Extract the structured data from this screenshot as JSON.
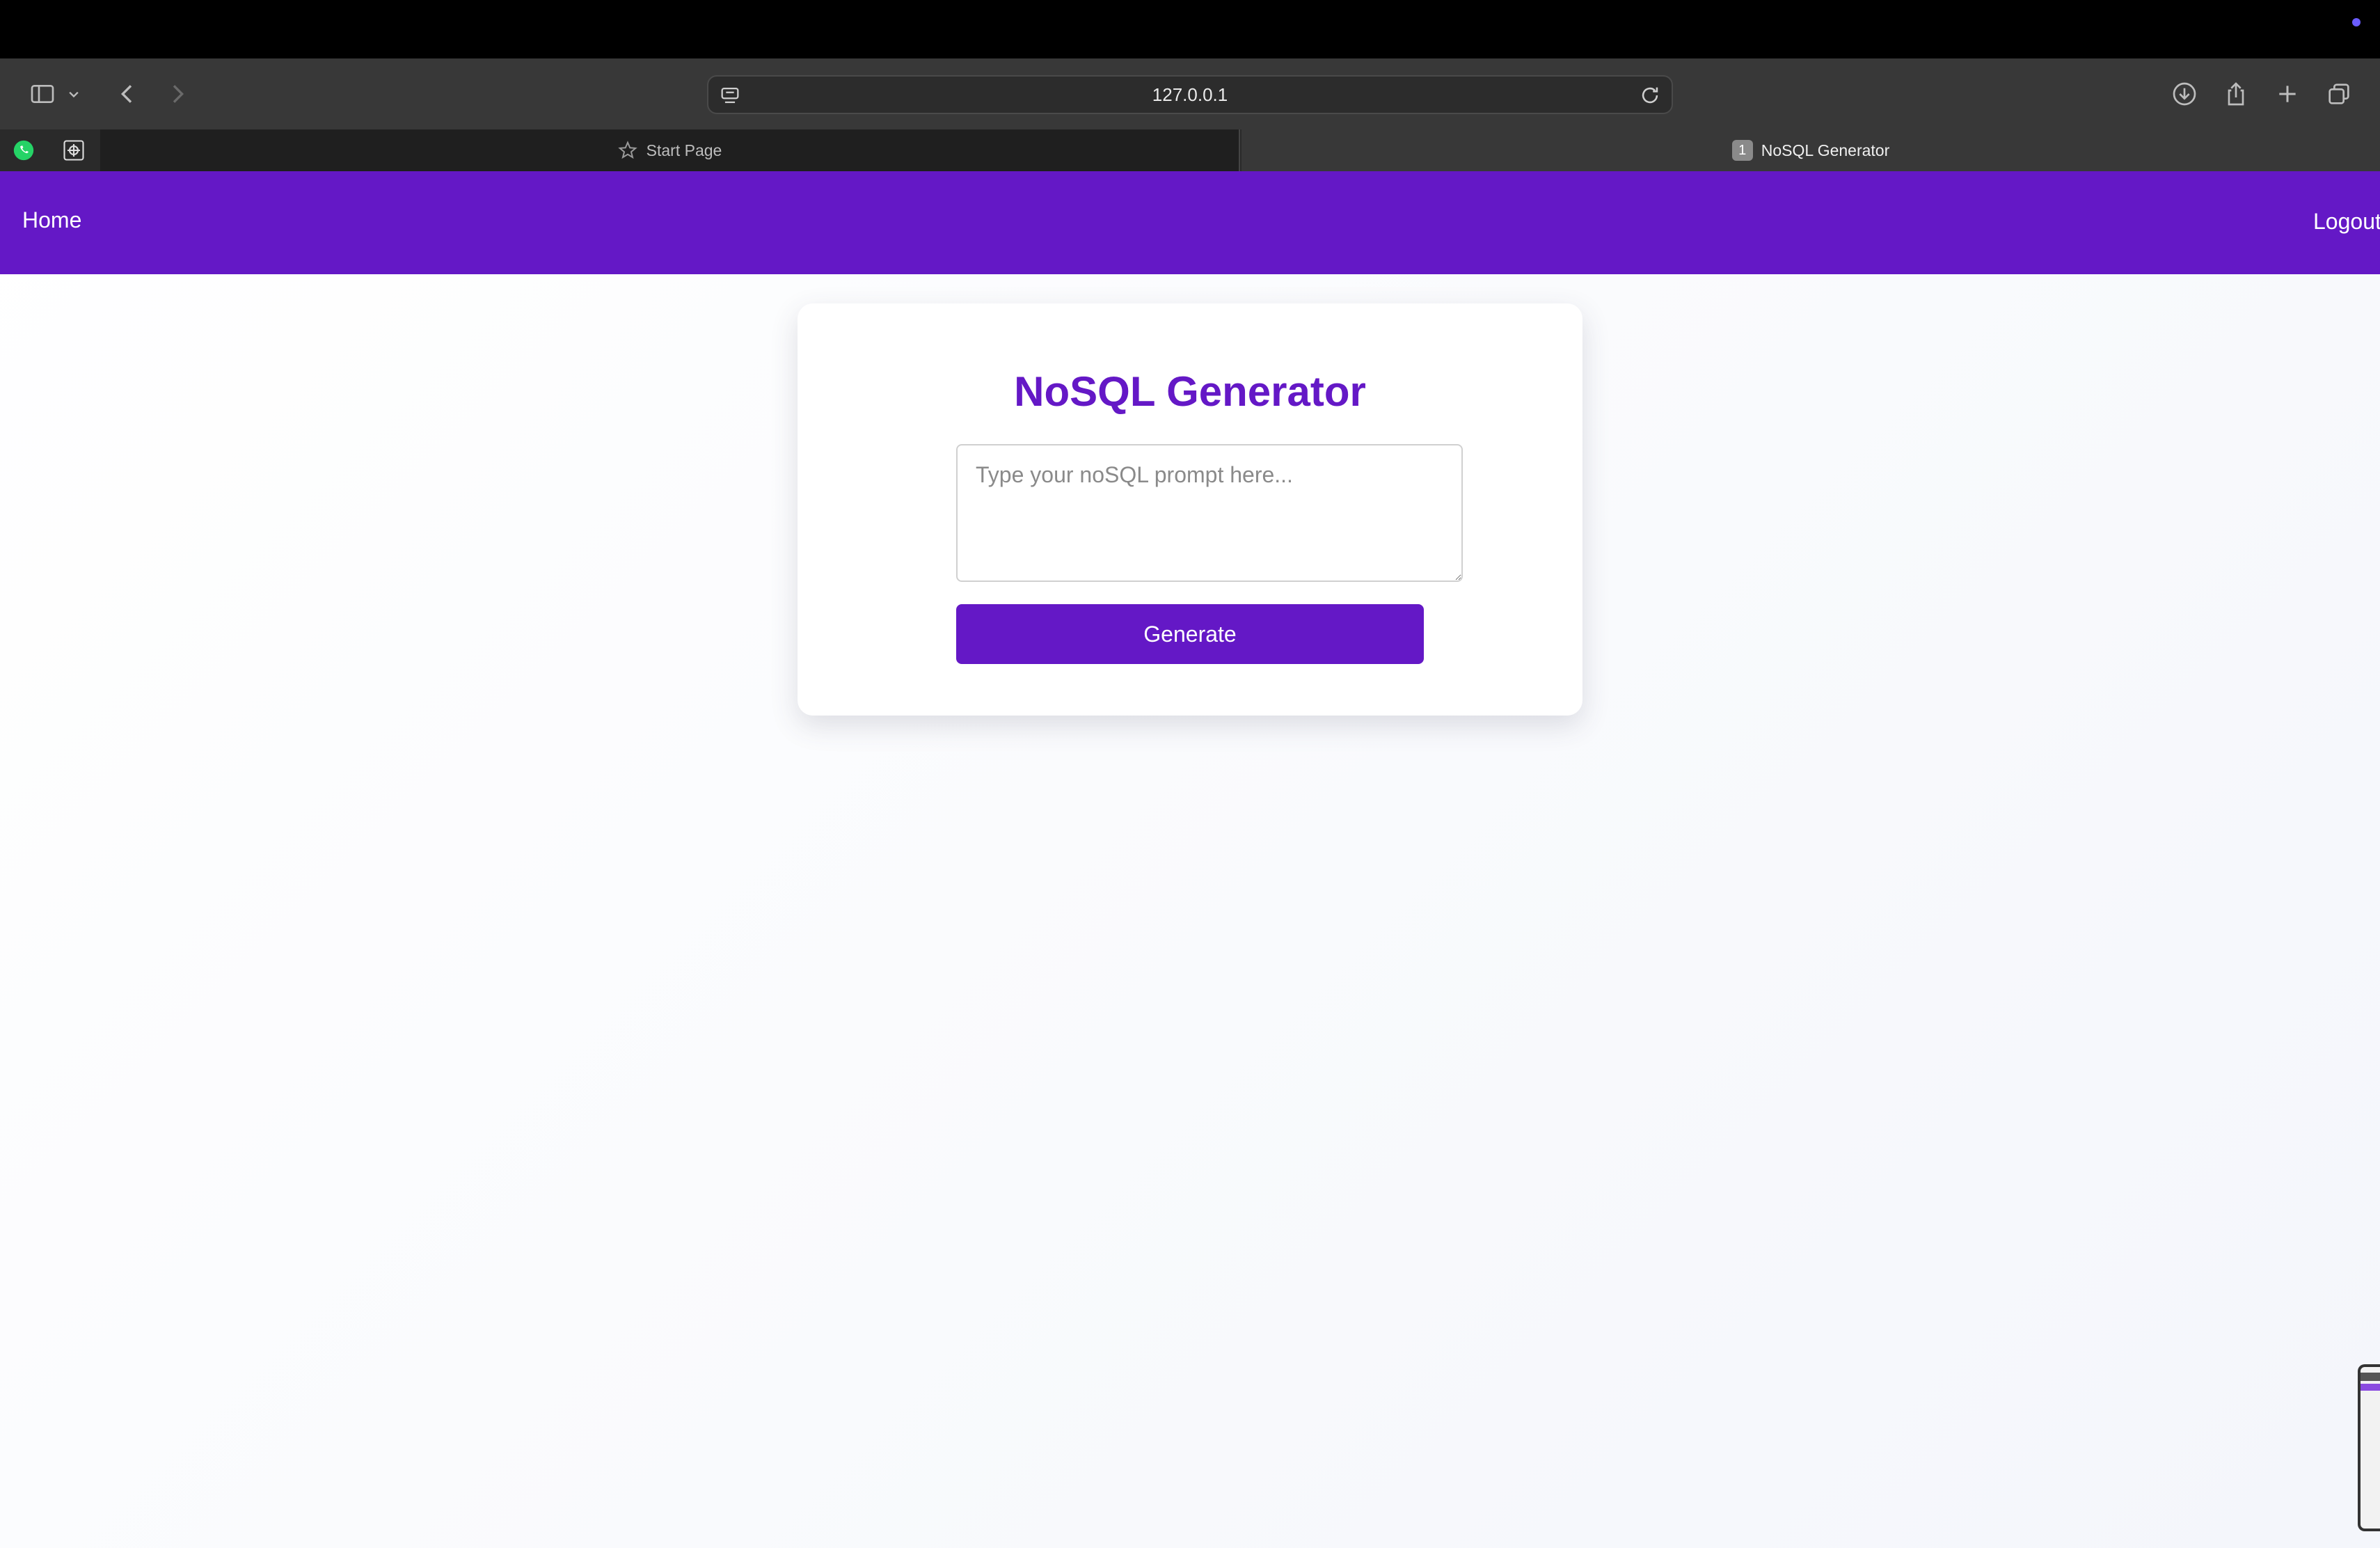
{
  "browser": {
    "address_url": "127.0.0.1",
    "tabs": [
      {
        "label": "Start Page",
        "active": false
      },
      {
        "label": "NoSQL Generator",
        "active": true,
        "badge": "1"
      }
    ]
  },
  "navbar": {
    "home_label": "Home",
    "logout_label": "Logout",
    "color": "#6418c6"
  },
  "generator": {
    "title": "NoSQL Generator",
    "prompt_value": "",
    "prompt_placeholder": "Type your noSQL prompt here...",
    "button_label": "Generate"
  }
}
